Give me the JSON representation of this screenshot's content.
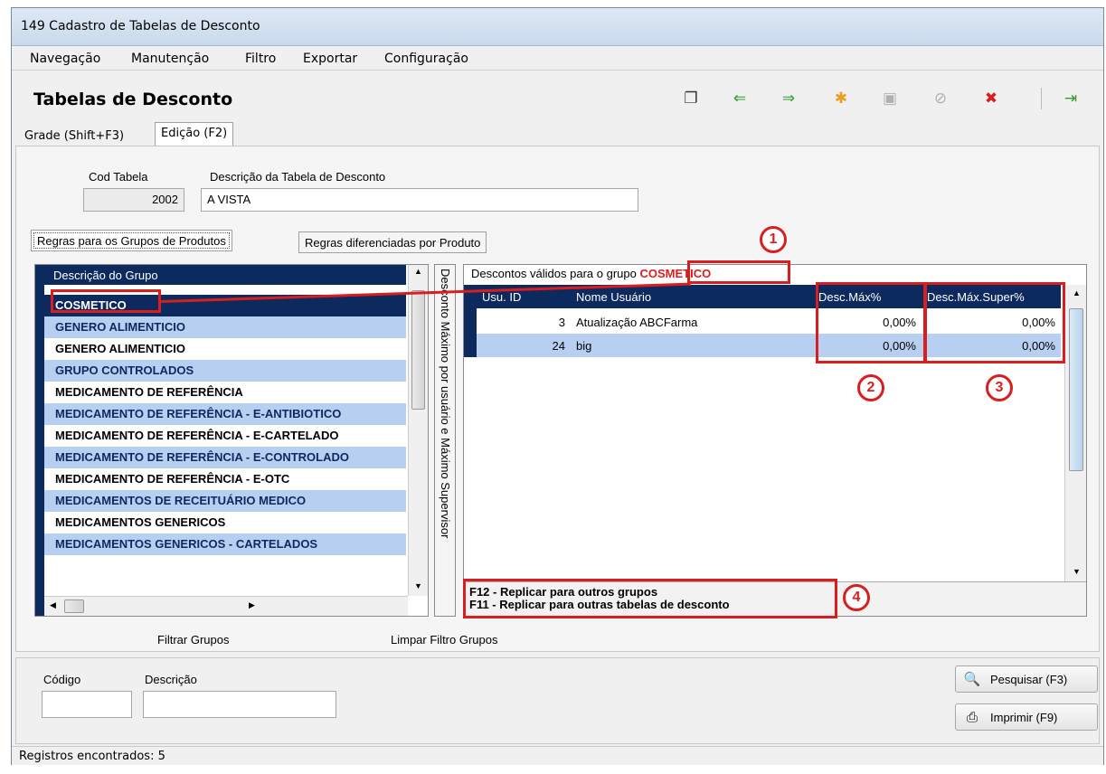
{
  "window": {
    "title": "149 Cadastro de Tabelas de Desconto"
  },
  "menu": [
    "Navegação",
    "Manutenção",
    "Filtro",
    "Exportar",
    "Configuração"
  ],
  "header": {
    "title": "Tabelas de Desconto"
  },
  "toolbar": [
    {
      "name": "copy-icon",
      "glyph": "❐",
      "color": "#333333"
    },
    {
      "name": "arrow-left-icon",
      "glyph": "⇐",
      "color": "#2e9e2e"
    },
    {
      "name": "arrow-right-icon",
      "glyph": "⇒",
      "color": "#2e9e2e"
    },
    {
      "name": "new-icon",
      "glyph": "✱",
      "color": "#e8a020"
    },
    {
      "name": "save-icon",
      "glyph": "▣",
      "color": "#b0b0b0"
    },
    {
      "name": "cancel-icon",
      "glyph": "⊘",
      "color": "#b0b0b0"
    },
    {
      "name": "delete-icon",
      "glyph": "✖",
      "color": "#d82020"
    },
    {
      "name": "exit-icon",
      "glyph": "⇥",
      "color": "#2e9e2e"
    }
  ],
  "main_tabs": [
    "Grade (Shift+F3)",
    "Edição (F2)"
  ],
  "form": {
    "cod_label": "Cod Tabela",
    "cod_value": "2002",
    "desc_label": "Descrição da Tabela de Desconto",
    "desc_value": "A VISTA"
  },
  "sub_tabs": [
    "Regras para os Grupos de Produtos",
    "Regras diferenciadas por Produto"
  ],
  "groups": {
    "header": "Descrição do Grupo",
    "rows": [
      "COSMETICO",
      "GENERO ALIMENTICIO",
      "GENERO ALIMENTICIO",
      "GRUPO CONTROLADOS",
      "MEDICAMENTO DE REFERÊNCIA",
      "MEDICAMENTO DE REFERÊNCIA - E-ANTIBIOTICO",
      "MEDICAMENTO DE REFERÊNCIA - E-CARTELADO",
      "MEDICAMENTO DE REFERÊNCIA - E-CONTROLADO",
      "MEDICAMENTO DE REFERÊNCIA - E-OTC",
      "MEDICAMENTOS DE RECEITUÁRIO MEDICO",
      "MEDICAMENTOS GENERICOS",
      "MEDICAMENTOS GENERICOS - CARTELADOS"
    ]
  },
  "vertical_caption": "Desconto Máximo por usuário e Máximo Supervisor",
  "discounts": {
    "title_prefix": "Descontos válidos para o grupo",
    "title_group": "COSMETICO",
    "columns": [
      "Usu. ID",
      "Nome Usuário",
      "Desc.Máx%",
      "Desc.Máx.Super%"
    ],
    "rows": [
      {
        "id": "3",
        "name": "Atualização ABCFarma",
        "max": "0,00%",
        "super": "0,00%"
      },
      {
        "id": "24",
        "name": "big",
        "max": "0,00%",
        "super": "0,00%"
      }
    ],
    "footer_line1": "F12 - Replicar para outros grupos",
    "footer_line2": "F11 - Replicar para outras tabelas de desconto"
  },
  "links": {
    "filter": "Filtrar Grupos",
    "clear": "Limpar Filtro Grupos"
  },
  "search": {
    "code_label": "Código",
    "desc_label": "Descrição",
    "search_button": "Pesquisar (F3)",
    "print_button": "Imprimir (F9)"
  },
  "status": "Registros encontrados: 5",
  "annotations": [
    "1",
    "2",
    "3",
    "4"
  ],
  "colors": {
    "accent": "#d81e1e",
    "navy": "#0c2a5e",
    "row_blue": "#b7cff0"
  }
}
